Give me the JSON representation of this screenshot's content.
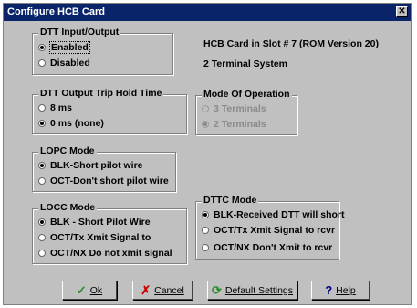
{
  "window": {
    "title": "Configure HCB Card",
    "close_glyph": "✕"
  },
  "info": {
    "card_slot": "HCB Card in Slot #  7 (ROM Version 20)",
    "system": "2 Terminal System"
  },
  "groups": {
    "dtt_io": {
      "label": "DTT Input/Output",
      "options": [
        "Enabled",
        "Disabled"
      ],
      "selected": 0
    },
    "dtt_hold": {
      "label": "DTT Output Trip Hold Time",
      "options": [
        "8 ms",
        "0 ms (none)"
      ],
      "selected": 1
    },
    "mode_op": {
      "label": "Mode Of Operation",
      "options": [
        "3 Terminals",
        "2 Terminals"
      ],
      "selected": 1,
      "enabled": false
    },
    "lopc": {
      "label": "LOPC Mode",
      "options": [
        "BLK-Short pilot wire",
        "OCT-Don't short pilot wire"
      ],
      "selected": 0
    },
    "locc": {
      "label": "LOCC Mode",
      "options": [
        "BLK - Short Pilot Wire",
        "OCT/Tx Xmit Signal to",
        "OCT/NX Do not xmit signal"
      ],
      "selected": 0
    },
    "dttc": {
      "label": "DTTC Mode",
      "options": [
        "BLK-Received DTT will short",
        "OCT/Tx Xmit Signal to rcvr",
        "OCT/NX Don't Xmit to rcvr"
      ],
      "selected": 0
    }
  },
  "buttons": {
    "ok": {
      "label": "Ok",
      "icon": "check-icon",
      "color": "#2e8b2e"
    },
    "cancel": {
      "label": "Cancel",
      "icon": "x-icon",
      "color": "#cc0000"
    },
    "defaults": {
      "label": "Default Settings",
      "icon": "refresh-icon",
      "color": "#2e8b2e"
    },
    "help": {
      "label": "Help",
      "icon": "question-icon",
      "color": "#000080"
    }
  }
}
